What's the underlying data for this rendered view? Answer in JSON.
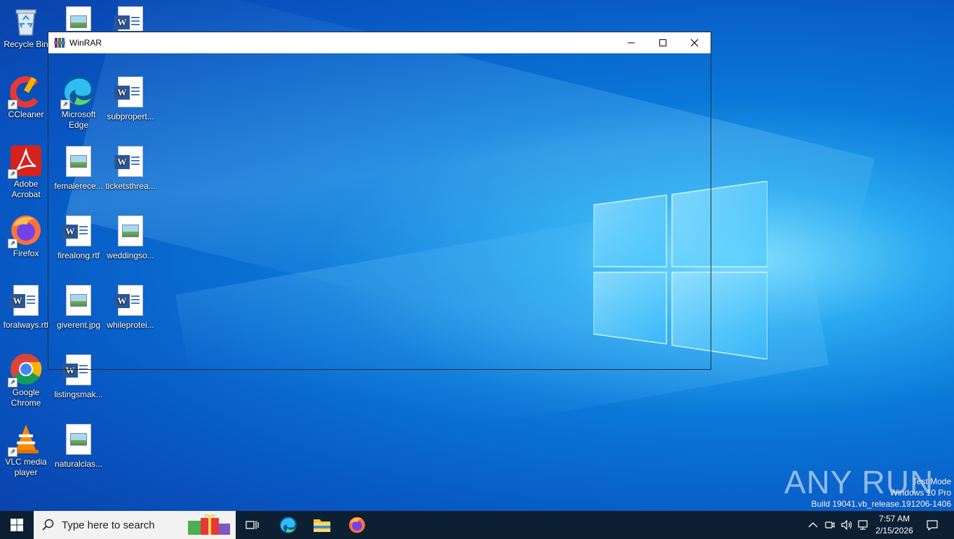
{
  "desktop": {
    "icons_left": [
      {
        "label": "Recycle Bin",
        "icon": "recycle-bin-icon"
      },
      {
        "label": "CCleaner",
        "icon": "ccleaner-icon"
      },
      {
        "label": "Adobe Acrobat",
        "icon": "adobe-acrobat-icon"
      },
      {
        "label": "Firefox",
        "icon": "firefox-icon"
      },
      {
        "label": "foralways.rtf",
        "icon": "word-document-icon"
      },
      {
        "label": "Google Chrome",
        "icon": "chrome-icon"
      },
      {
        "label": "VLC media player",
        "icon": "vlc-icon"
      }
    ],
    "icons_col2": [
      {
        "label": "Microsoft Edge",
        "icon": "edge-icon"
      },
      {
        "label": "femalerece...",
        "icon": "image-file-icon"
      },
      {
        "label": "firealong.rtf",
        "icon": "word-document-icon"
      },
      {
        "label": "giverent.jpg",
        "icon": "image-file-icon"
      },
      {
        "label": "listingsmak...",
        "icon": "word-document-icon"
      },
      {
        "label": "naturalclas...",
        "icon": "image-file-icon"
      }
    ],
    "icons_col3": [
      {
        "label": "subpropert...",
        "icon": "word-document-icon"
      },
      {
        "label": "ticketsthrea...",
        "icon": "word-document-icon"
      },
      {
        "label": "weddingso...",
        "icon": "image-file-icon"
      },
      {
        "label": "whileprotei...",
        "icon": "word-document-icon"
      }
    ]
  },
  "window": {
    "title": "WinRAR",
    "minimize_label": "Minimize",
    "maximize_label": "Maximize",
    "close_label": "Close"
  },
  "taskbar": {
    "search_placeholder": "Type here to search",
    "pinned": [
      "task-view-icon",
      "edge-icon",
      "file-explorer-icon",
      "firefox-icon"
    ],
    "time": "7:57 AM",
    "date": "2/15/2026"
  },
  "watermark": {
    "line1": "Test Mode",
    "line2": "Windows 10 Pro",
    "line3": "Build 19041.vb_release.191206-1406",
    "brand": "ANY RUN"
  },
  "colors": {
    "taskbar_bg": "#0c1f33",
    "desktop_accent": "#0a78d8"
  }
}
